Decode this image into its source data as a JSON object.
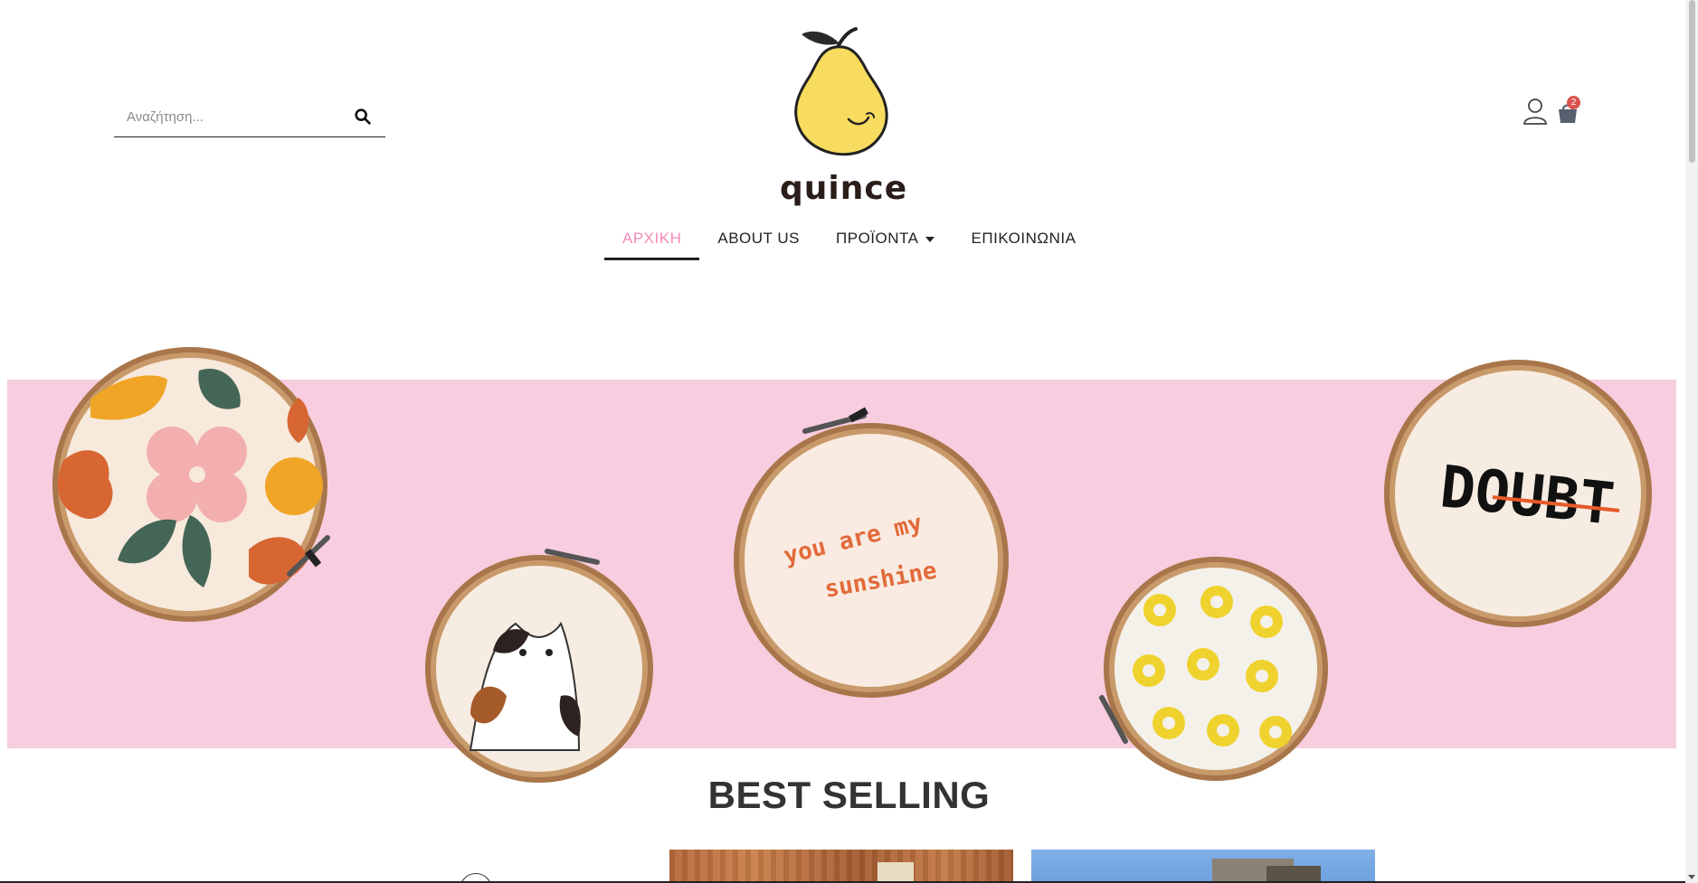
{
  "header": {
    "search_placeholder": "Αναζήτηση...",
    "logo_text": "quince",
    "cart_count": "2"
  },
  "nav": {
    "items": [
      {
        "label": "ΑΡΧΙΚΗ",
        "active": true
      },
      {
        "label": "ABOUT US",
        "active": false
      },
      {
        "label": "ΠΡΟΪΟΝΤΑ",
        "active": false,
        "has_dropdown": true
      },
      {
        "label": "ΕΠΙΚΟΙΝΩΝΙΑ",
        "active": false
      }
    ]
  },
  "hero": {
    "hoop_text_1": "you are my",
    "hoop_text_2": "sunshine",
    "hoop_text_doubt": "DOUBT"
  },
  "best_selling": {
    "title": "BEST SELLING"
  },
  "colors": {
    "accent_pink": "#f28bb5",
    "hero_bg": "#f8cddf",
    "logo_yellow": "#f7dc5f",
    "cart_badge": "#d9534f"
  },
  "icons": [
    "search-icon",
    "user-icon",
    "shopping-bag-icon",
    "chevron-down-icon",
    "arrow-left-icon"
  ]
}
